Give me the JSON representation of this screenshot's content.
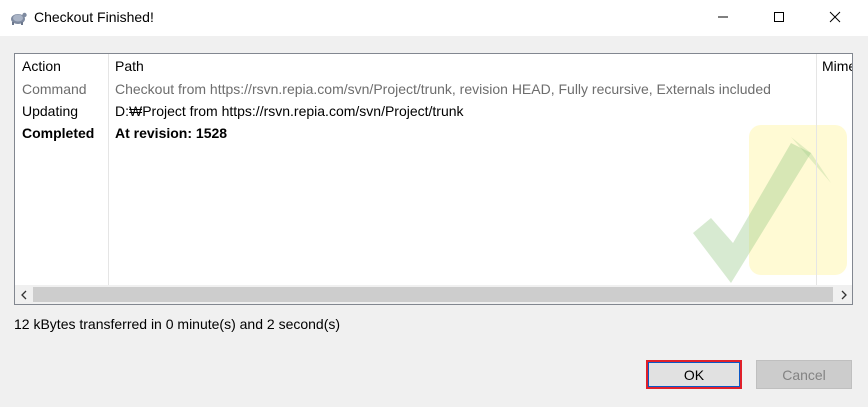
{
  "window": {
    "title": "Checkout Finished!",
    "app_icon": "tortoise-icon"
  },
  "list": {
    "columns": [
      "Action",
      "Path",
      "Mime"
    ],
    "rows": [
      {
        "action": "Command",
        "path": "Checkout from https://rsvn.repia.com/svn/Project/trunk, revision HEAD, Fully recursive, Externals included"
      },
      {
        "action": "Updating",
        "path": "D:₩Project from https://rsvn.repia.com/svn/Project/trunk"
      },
      {
        "action": "Completed",
        "path": "At revision: 1528"
      }
    ]
  },
  "status": {
    "text": "12 kBytes transferred in 0 minute(s) and 2 second(s)"
  },
  "buttons": {
    "ok": "OK",
    "cancel": "Cancel"
  },
  "colors": {
    "ok_highlight": "#e0202a",
    "watermark_green": "#8cc37a",
    "watermark_yellow": "#fff6b0"
  }
}
